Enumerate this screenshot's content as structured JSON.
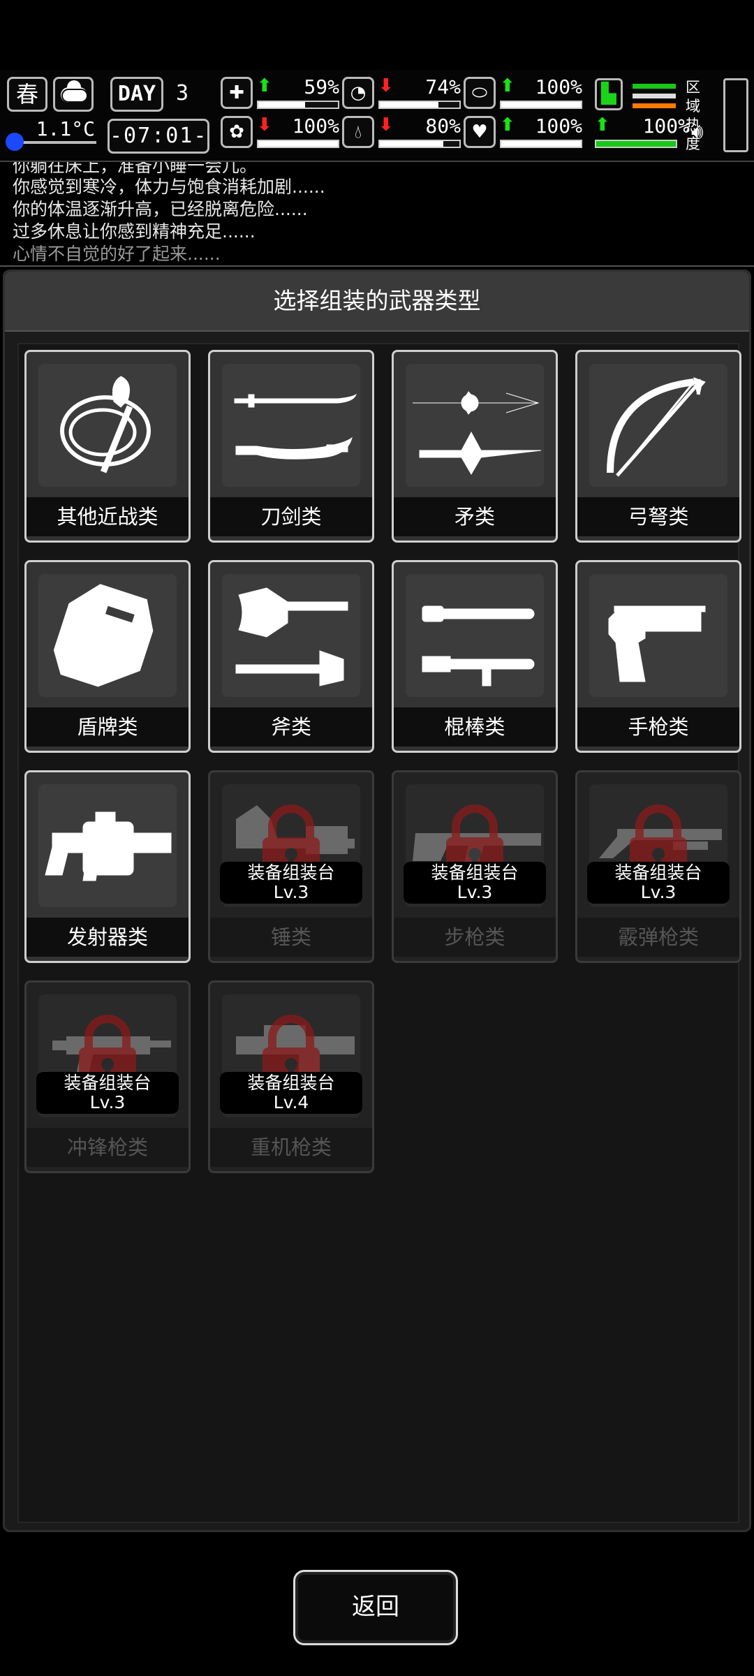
{
  "hud": {
    "season": "春",
    "temperature": "1.1°C",
    "day_label": "DAY",
    "day_number": "3",
    "clock": "-07:01-",
    "region_label": "区域热度",
    "stats": [
      {
        "name": "health",
        "icon": "medkit-icon",
        "trend": "up",
        "value": "59%",
        "level": 0.59
      },
      {
        "name": "hunger",
        "icon": "stomach-icon",
        "trend": "down",
        "value": "74%",
        "level": 0.74
      },
      {
        "name": "stamina",
        "icon": "capsule-icon",
        "trend": "up",
        "value": "100%",
        "level": 1.0
      },
      {
        "name": "mental",
        "icon": "brain-icon",
        "trend": "down",
        "value": "100%",
        "level": 1.0
      },
      {
        "name": "thirst",
        "icon": "water-drop-icon",
        "trend": "down",
        "value": "80%",
        "level": 0.8
      },
      {
        "name": "mood",
        "icon": "heart-icon",
        "trend": "up",
        "value": "100%",
        "level": 1.0
      },
      {
        "name": "legs",
        "icon": "boot-icon",
        "trend": "up",
        "value": "100%",
        "level": 1.0,
        "accent": "#17c917"
      }
    ],
    "heat_colors": [
      "#17c917",
      "#dddddd",
      "#ff7a00"
    ]
  },
  "log": [
    "你躺在床上，准备小睡一会儿。",
    "你感觉到寒冷，体力与饱食消耗加剧......",
    "你的体温逐渐升高，已经脱离危险......",
    "过多休息让你感到精神充足......",
    "心情不自觉的好了起来......"
  ],
  "panel": {
    "title": "选择组装的武器类型",
    "categories": [
      {
        "label": "其他近战类",
        "icon": "shovel-whip-icon",
        "locked": false
      },
      {
        "label": "刀剑类",
        "icon": "sword-icon",
        "locked": false
      },
      {
        "label": "矛类",
        "icon": "spear-icon",
        "locked": false
      },
      {
        "label": "弓弩类",
        "icon": "bow-icon",
        "locked": false
      },
      {
        "label": "盾牌类",
        "icon": "riot-shield-icon",
        "locked": false
      },
      {
        "label": "斧类",
        "icon": "axe-icon",
        "locked": false
      },
      {
        "label": "棍棒类",
        "icon": "baton-icon",
        "locked": false
      },
      {
        "label": "手枪类",
        "icon": "pistol-icon",
        "locked": false
      },
      {
        "label": "发射器类",
        "icon": "grenade-launcher-icon",
        "locked": false
      },
      {
        "label": "锤类",
        "icon": "hammer-icon",
        "locked": true,
        "requirement": "装备组装台",
        "level": "Lv.3"
      },
      {
        "label": "步枪类",
        "icon": "rifle-icon",
        "locked": true,
        "requirement": "装备组装台",
        "level": "Lv.3"
      },
      {
        "label": "霰弹枪类",
        "icon": "shotgun-icon",
        "locked": true,
        "requirement": "装备组装台",
        "level": "Lv.3"
      },
      {
        "label": "冲锋枪类",
        "icon": "smg-icon",
        "locked": true,
        "requirement": "装备组装台",
        "level": "Lv.3"
      },
      {
        "label": "重机枪类",
        "icon": "heavy-machine-gun-icon",
        "locked": true,
        "requirement": "装备组装台",
        "level": "Lv.4"
      }
    ]
  },
  "back_label": "返回",
  "colors": {
    "lock": "#8b1a1a",
    "up": "#17e317",
    "down": "#ff2222",
    "temp": "#1c48ff"
  }
}
